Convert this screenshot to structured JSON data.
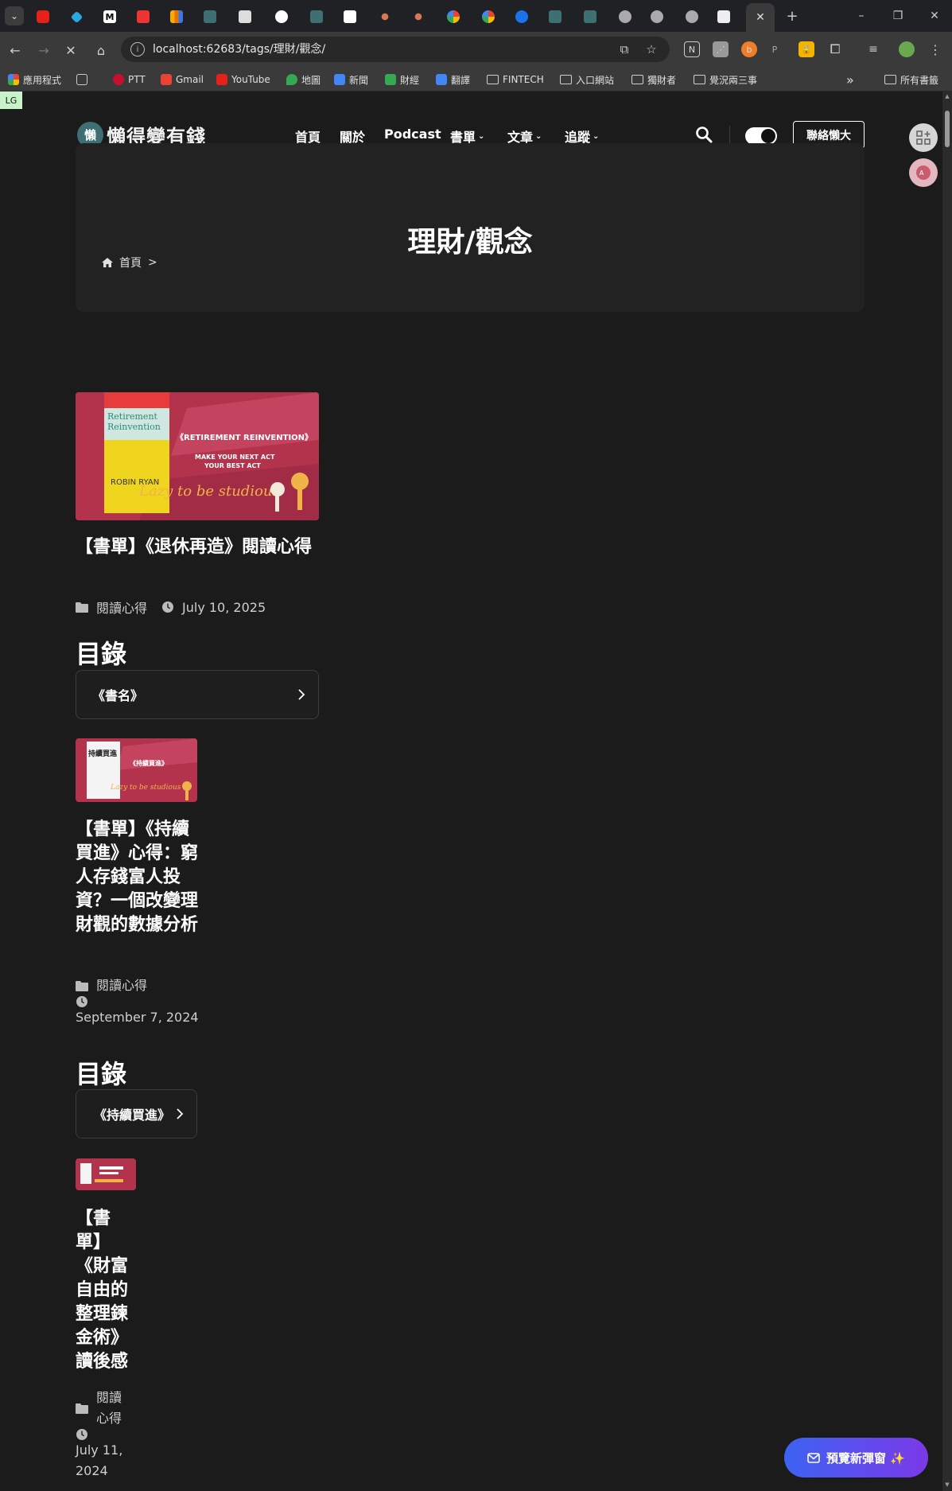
{
  "browser": {
    "url": "localhost:62683/tags/理財/觀念/",
    "new_tab": "+",
    "window_controls": [
      "–",
      "❐",
      "✕"
    ],
    "tab_close": "✕",
    "bookmarks": [
      {
        "label": "應用程式",
        "icon": "apps-icon"
      },
      {
        "label": "PTT",
        "icon": "ptt-icon"
      },
      {
        "label": "Gmail",
        "icon": "gmail-icon"
      },
      {
        "label": "YouTube",
        "icon": "youtube-icon"
      },
      {
        "label": "地圖",
        "icon": "maps-icon"
      },
      {
        "label": "新聞",
        "icon": "news-icon"
      },
      {
        "label": "財經",
        "icon": "finance-icon"
      },
      {
        "label": "翻譯",
        "icon": "translate-icon"
      },
      {
        "label": "FINTECH",
        "icon": "folder-icon"
      },
      {
        "label": "入口網站",
        "icon": "folder-icon"
      },
      {
        "label": "獨財者",
        "icon": "folder-icon"
      },
      {
        "label": "覺況兩三事",
        "icon": "folder-icon"
      }
    ],
    "bookmarks_more": "»",
    "all_bookmarks": "所有書籤"
  },
  "site": {
    "badge": "LG",
    "logo_glyph": "懶",
    "logo_text": "懶得變有錢",
    "nav": [
      "首頁",
      "關於",
      "Podcast",
      "書單",
      "文章",
      "追蹤"
    ],
    "contact": "聯絡懶大",
    "hero_title": "理財/觀念",
    "breadcrumb_home": "首頁",
    "breadcrumb_sep": ">"
  },
  "posts": [
    {
      "title": "【書單】《退休再造》閱讀心得",
      "category": "閱讀心得",
      "date": "July 10, 2025",
      "toc_heading": "目錄",
      "toc_item": "《書名》",
      "cover": {
        "book_title": "Retirement Reinvention",
        "headline": "《RETIREMENT REINVENTION》",
        "sub": "MAKE YOUR NEXT ACT YOUR BEST ACT",
        "author": "ROBIN RYAN",
        "script": "Lazy to be studious"
      }
    },
    {
      "title": "【書單】《持續買進》心得：窮人存錢富人投資？一個改變理財觀的數據分析",
      "category": "閱讀心得",
      "date": "September 7, 2024",
      "toc_heading": "目錄",
      "toc_item": "《持續買進》",
      "cover": {
        "book_title": "持續買進",
        "headline": "《持續買進》",
        "script": "Lazy to be studious"
      }
    },
    {
      "title": "【書單】《財富自由的整理鍊金術》讀後感",
      "category": "閱讀心得",
      "date": "July 11, 2024"
    }
  ],
  "floating": {
    "preview_label": "預覽新彈窗 ✨"
  },
  "colors": {
    "bg": "#1b1b1b",
    "accent_gradient_start": "#3d63f2",
    "accent_gradient_end": "#7b39e8",
    "cover_red": "#b3334d"
  }
}
